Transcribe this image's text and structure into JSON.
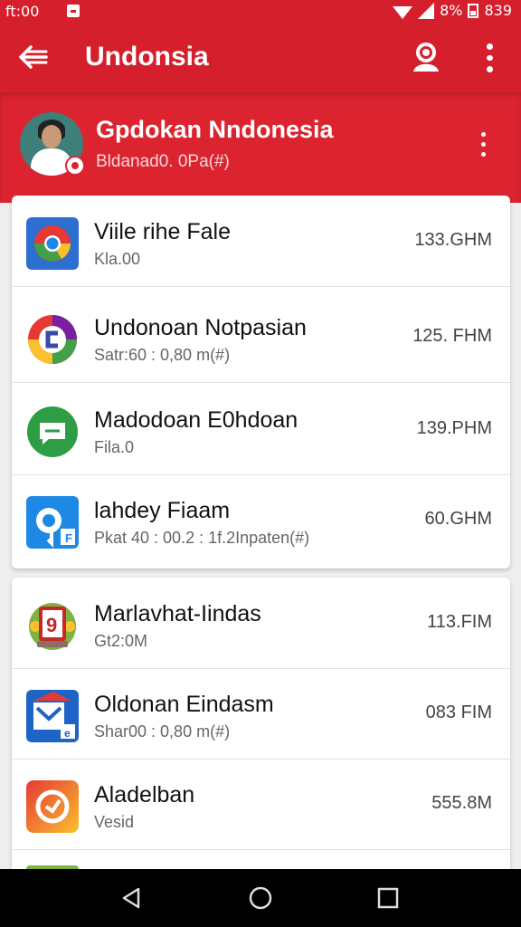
{
  "status_bar": {
    "time": "ft:00",
    "battery": "8%",
    "clock_right": "839"
  },
  "toolbar": {
    "title": "Undonsia"
  },
  "header": {
    "name": "Gpdokan Nndonesia",
    "subtitle": "Bldanad0. 0Pa(#)"
  },
  "card1": {
    "items": [
      {
        "title": "Viile rihe Fale",
        "subtitle": "Kla.00",
        "size": "133.GHM",
        "icon": "chrome-icon"
      },
      {
        "title": "Undonoan Notpasian",
        "subtitle": "Satr:60 : 0,80 m(#)",
        "size": "125. FHM",
        "icon": "browser-icon"
      },
      {
        "title": "Madodoan E0hdoan",
        "subtitle": "Fila.0",
        "size": "139.PHM",
        "icon": "chat-icon"
      },
      {
        "title": "lahdey Fiaam",
        "subtitle": "Pkat 40 : 00.2 : 1f.2Inpaten(#)",
        "size": "60.GHM",
        "icon": "map-icon"
      }
    ]
  },
  "card2": {
    "items": [
      {
        "title": "Marlavhat-Iindas",
        "subtitle": "Gt2:0M",
        "size": "113.FIM",
        "icon": "emblem-icon"
      },
      {
        "title": "Oldonan Eindasm",
        "subtitle": "Shar00 : 0,80 m(#)",
        "size": "083 FIM",
        "icon": "mail-icon"
      },
      {
        "title": "Aladelban",
        "subtitle": "Vesid",
        "size": "555.8M",
        "icon": "clock-icon"
      }
    ]
  },
  "colors": {
    "primary": "#d61f2c",
    "header": "#dc2430"
  }
}
